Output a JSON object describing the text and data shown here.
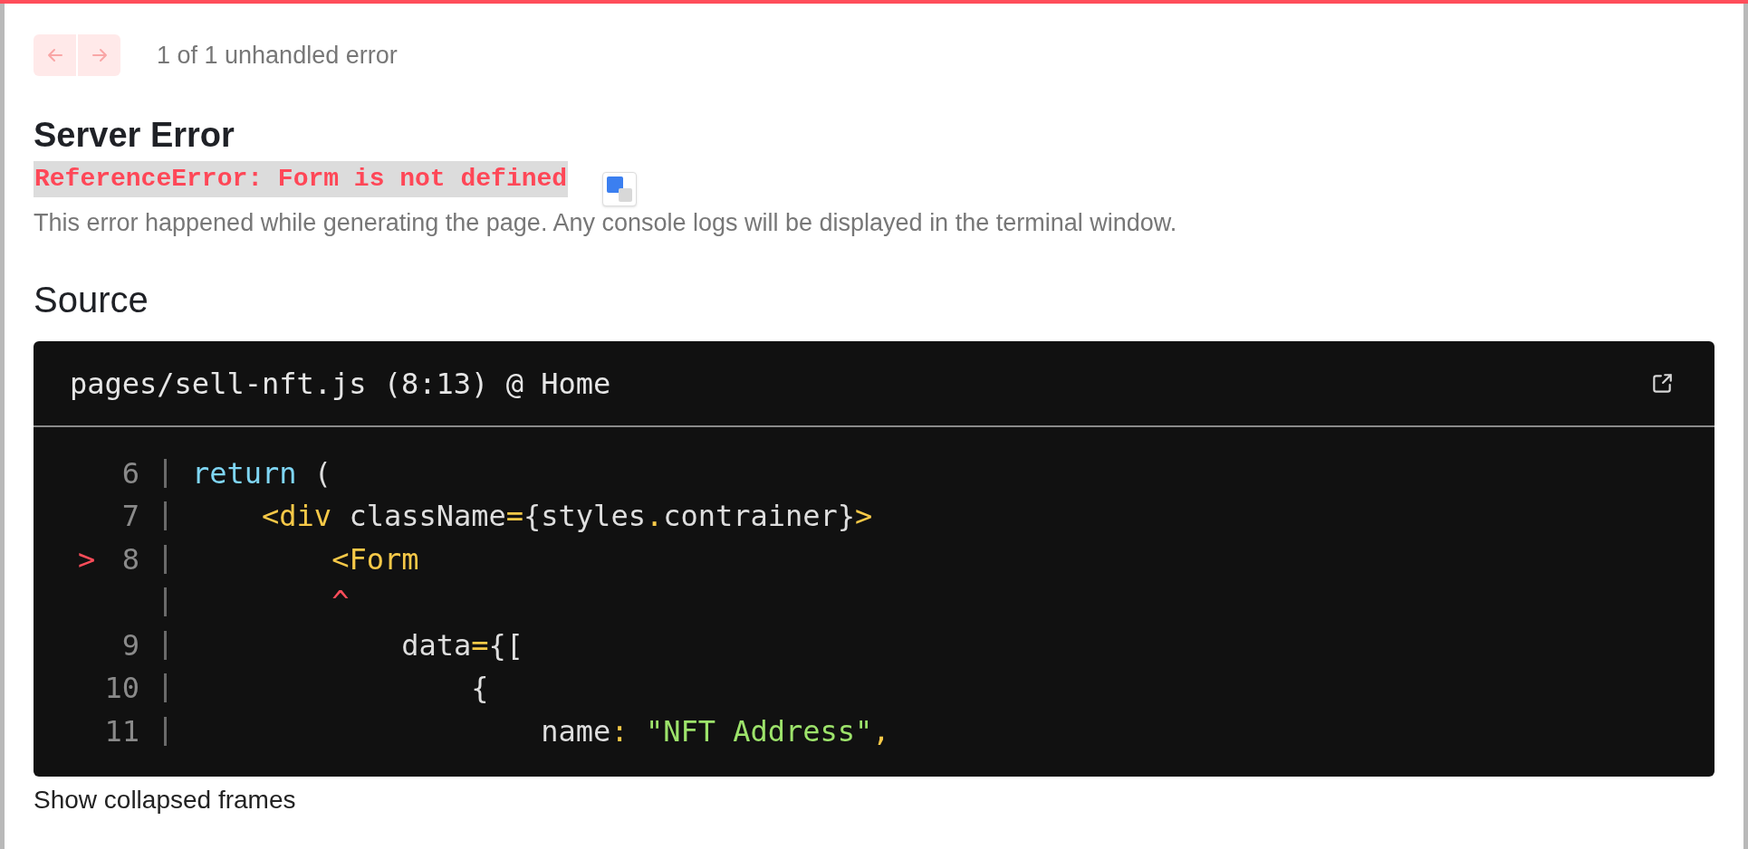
{
  "nav": {
    "buttons": [
      {
        "kind": "previous",
        "disabled": true
      },
      {
        "kind": "next",
        "disabled": true
      }
    ],
    "counter": "1 of 1 unhandled error"
  },
  "title": "Server Error",
  "error_message": "ReferenceError: Form is not defined",
  "description": "This error happened while generating the page. Any console logs will be displayed in the terminal window.",
  "translate_popup": {
    "shown": true
  },
  "source": {
    "heading": "Source",
    "file": "pages/sell-nft.js (8:13) @ Home",
    "lines": [
      {
        "number": "6",
        "tokens": [
          {
            "kind": "keyword",
            "text": "return"
          },
          {
            "kind": "plain",
            "text": " ("
          }
        ]
      },
      {
        "number": "7",
        "tokens": [
          {
            "kind": "punct",
            "text": "    <div"
          },
          {
            "kind": "plain",
            "text": " className"
          },
          {
            "kind": "punct",
            "text": "="
          },
          {
            "kind": "plain",
            "text": "{styles"
          },
          {
            "kind": "punct",
            "text": "."
          },
          {
            "kind": "plain",
            "text": "contrainer}"
          },
          {
            "kind": "punct",
            "text": ">"
          }
        ]
      },
      {
        "number": "8",
        "marker": ">",
        "tokens": [
          {
            "kind": "punct",
            "text": "        <Form"
          }
        ]
      },
      {
        "tokens": [
          {
            "kind": "caret",
            "text": "        ^"
          }
        ]
      },
      {
        "number": "9",
        "tokens": [
          {
            "kind": "plain",
            "text": "            data"
          },
          {
            "kind": "punct",
            "text": "="
          },
          {
            "kind": "plain",
            "text": "{["
          }
        ]
      },
      {
        "number": "10",
        "tokens": [
          {
            "kind": "plain",
            "text": "                {"
          }
        ]
      },
      {
        "number": "11",
        "tokens": [
          {
            "kind": "plain",
            "text": "                    name"
          },
          {
            "kind": "punct",
            "text": ":"
          },
          {
            "kind": "string",
            "text": " \"NFT Address\""
          },
          {
            "kind": "punct",
            "text": ","
          }
        ]
      }
    ]
  },
  "footer_link": "Show collapsed frames"
}
